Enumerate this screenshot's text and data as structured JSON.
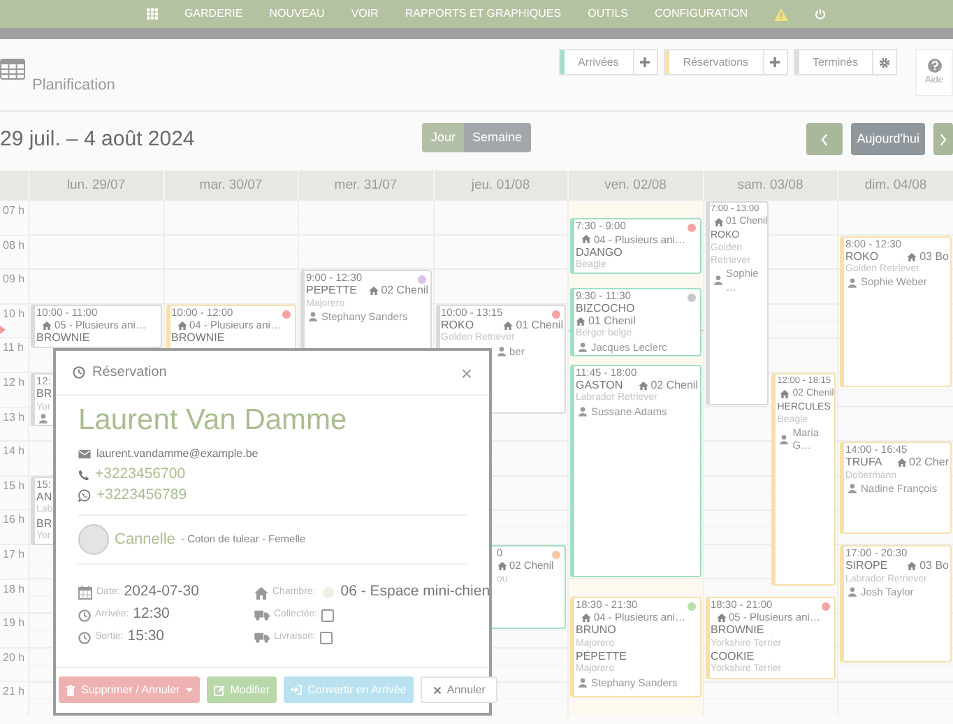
{
  "nav": {
    "items": [
      "GARDERIE",
      "NOUVEAU",
      "VOIR",
      "RAPPORTS ET GRAPHIQUES",
      "OUTILS",
      "CONFIGURATION"
    ]
  },
  "header": {
    "title": "Planification",
    "filters": [
      {
        "label": "Arrivées",
        "kind": "arrival"
      },
      {
        "label": "Réservations",
        "kind": "reservation"
      },
      {
        "label": "Terminés",
        "kind": "done"
      }
    ],
    "help": "Aide"
  },
  "toolbar": {
    "range": "29 juil. – 4 août 2024",
    "views": [
      {
        "label": "Jour",
        "selected": false
      },
      {
        "label": "Semaine",
        "selected": true
      }
    ],
    "today": "Aujourd'hui"
  },
  "calendar": {
    "hours": [
      "07 h",
      "08 h",
      "09 h",
      "10 h",
      "11 h",
      "12 h",
      "13 h",
      "14 h",
      "15 h",
      "16 h",
      "17 h",
      "18 h",
      "19 h",
      "20 h",
      "21 h"
    ],
    "current_time": {
      "level": 0.252
    },
    "days": [
      {
        "label": "lun. 29/07",
        "today": false,
        "events": [
          {
            "kind": "done",
            "lines": [
              {
                "kind": "time",
                "text": "10:00 - 11:00"
              },
              {
                "kind": "room",
                "text": "05 - Plusieurs ani…"
              },
              {
                "kind": "name",
                "text": "BROWNIE"
              }
            ]
          },
          {
            "kind": "done",
            "lines": [
              {
                "kind": "time",
                "text": "12:"
              },
              {
                "kind": "name",
                "text": "BR"
              },
              {
                "kind": "breed",
                "text": "Yor"
              },
              {
                "kind": "owner"
              }
            ]
          },
          {
            "kind": "done",
            "lines": [
              {
                "kind": "time",
                "text": "15:"
              },
              {
                "kind": "name",
                "text": "AN"
              },
              {
                "kind": "breed",
                "text": "Lab"
              },
              {
                "kind": "name",
                "text": "BR"
              },
              {
                "kind": "breed",
                "text": "Yor"
              }
            ]
          }
        ]
      },
      {
        "label": "mar. 30/07",
        "today": false,
        "events": [
          {
            "kind": "reservation",
            "color": "#f4a3a3",
            "lines": [
              {
                "kind": "time",
                "text": "10:00 - 12:00"
              },
              {
                "kind": "room",
                "text": "04 - Plusieurs ani…"
              },
              {
                "kind": "name",
                "text": "BROWNIE"
              }
            ]
          }
        ]
      },
      {
        "label": "mer. 31/07",
        "today": false,
        "events": [
          {
            "kind": "done",
            "color": "#dcc1ee",
            "lines": [
              {
                "kind": "time",
                "text": "9:00 - 12:30"
              },
              {
                "kind": "name",
                "text": "PEPETTE",
                "room": "02 Chenil"
              },
              {
                "kind": "breed",
                "text": "Majorero"
              },
              {
                "kind": "owner",
                "text": "Stephany Sanders"
              }
            ]
          }
        ]
      },
      {
        "label": "jeu. 01/08",
        "today": false,
        "events": [
          {
            "kind": "done",
            "color": "#f4a3a3",
            "lines": [
              {
                "kind": "time",
                "text": "10:00 - 13:15"
              },
              {
                "kind": "name",
                "text": "ROKO",
                "room": "01 Chenil"
              },
              {
                "kind": "breed",
                "text": "Golden Retriever"
              },
              {
                "kind": "owner",
                "text": "ber",
                "clipped": true
              }
            ]
          },
          {
            "kind": "arrival",
            "color": "#f8c9a0",
            "lines": [
              {
                "kind": "time",
                "text": "0",
                "clipped": true
              },
              {
                "kind": "room",
                "text": "02 Chenil",
                "clipped": true
              },
              {
                "kind": "breed",
                "text": "ou",
                "clipped": true
              }
            ]
          }
        ]
      },
      {
        "label": "ven. 02/08",
        "today": true,
        "events": [
          {
            "kind": "arrival",
            "color": "#f4a3a3",
            "lines": [
              {
                "kind": "time",
                "text": "7:30 - 9:00"
              },
              {
                "kind": "room",
                "text": "04 - Plusieurs ani…"
              },
              {
                "kind": "name",
                "text": "DJANGO"
              },
              {
                "kind": "breed",
                "text": "Beagle"
              }
            ]
          },
          {
            "kind": "arrival",
            "color": "#c8c8c8",
            "lines": [
              {
                "kind": "time",
                "text": "9:30 - 11:30"
              },
              {
                "kind": "name",
                "text": "BIZCOCHO",
                "room": "01 Chenil"
              },
              {
                "kind": "breed",
                "text": "Berger belge"
              },
              {
                "kind": "owner",
                "text": "Jacques Leclerc"
              }
            ]
          },
          {
            "kind": "arrival",
            "lines": [
              {
                "kind": "time",
                "text": "11:45 - 18:00"
              },
              {
                "kind": "name",
                "text": "GASTON",
                "room": "02 Chenil"
              },
              {
                "kind": "breed",
                "text": "Labrador Retriever"
              },
              {
                "kind": "owner",
                "text": "Sussane Adams"
              }
            ]
          },
          {
            "kind": "reservation",
            "color": "#b5e0a8",
            "lines": [
              {
                "kind": "time",
                "text": "18:30 - 21:30"
              },
              {
                "kind": "room",
                "text": "04 - Plusieurs ani…"
              },
              {
                "kind": "name",
                "text": "BRUNO"
              },
              {
                "kind": "breed",
                "text": "Majorero"
              },
              {
                "kind": "name",
                "text": "PÉPETTE"
              },
              {
                "kind": "breed",
                "text": "Majorero"
              },
              {
                "kind": "owner",
                "text": "Stephany Sanders"
              }
            ]
          }
        ]
      },
      {
        "label": "sam. 03/08",
        "today": false,
        "events": [
          {
            "kind": "done",
            "lines": [
              {
                "kind": "time",
                "text": "7:00 - 13:00"
              },
              {
                "kind": "room",
                "text": "01 Chenil"
              },
              {
                "kind": "name",
                "text": "ROKO"
              },
              {
                "kind": "breed",
                "text": "Golden"
              },
              {
                "kind": "breed",
                "text": "Retriever"
              },
              {
                "kind": "owner",
                "text": "Sophie …"
              }
            ]
          },
          {
            "kind": "reservation",
            "lines": [
              {
                "kind": "time",
                "text": "12:00 - 18:15"
              },
              {
                "kind": "room",
                "text": "02 Chenil"
              },
              {
                "kind": "name",
                "text": "HERCULES"
              },
              {
                "kind": "breed",
                "text": "Beagle"
              },
              {
                "kind": "owner",
                "text": "Maria G…"
              }
            ]
          },
          {
            "kind": "reservation",
            "color": "#f4a3a3",
            "lines": [
              {
                "kind": "time",
                "text": "18:30 - 21:00"
              },
              {
                "kind": "room",
                "text": "05 - Plusieurs ani…"
              },
              {
                "kind": "name",
                "text": "BROWNIE"
              },
              {
                "kind": "breed",
                "text": "Yorkshire Terrier"
              },
              {
                "kind": "name",
                "text": "COOKIE"
              },
              {
                "kind": "breed",
                "text": "Yorkshire Terrier"
              }
            ]
          }
        ]
      },
      {
        "label": "dim. 04/08",
        "today": false,
        "events": [
          {
            "kind": "reservation",
            "lines": [
              {
                "kind": "time",
                "text": "8:00 - 12:30"
              },
              {
                "kind": "name",
                "text": "ROKO",
                "room": "03 Bo"
              },
              {
                "kind": "breed",
                "text": "Golden Retriever"
              },
              {
                "kind": "owner",
                "text": "Sophie Weber"
              }
            ]
          },
          {
            "kind": "reservation",
            "lines": [
              {
                "kind": "time",
                "text": "14:00 - 16:45"
              },
              {
                "kind": "name",
                "text": "TRUFA",
                "room": "02 Cher"
              },
              {
                "kind": "breed",
                "text": "Dobermann"
              },
              {
                "kind": "owner",
                "text": "Nadine François"
              }
            ]
          },
          {
            "kind": "reservation",
            "lines": [
              {
                "kind": "time",
                "text": "17:00 - 20:30"
              },
              {
                "kind": "name",
                "text": "SIROPE",
                "room": "03 Bo"
              },
              {
                "kind": "breed",
                "text": "Labrador Retriever"
              },
              {
                "kind": "owner",
                "text": "Josh Taylor"
              }
            ]
          }
        ]
      }
    ]
  },
  "dialog": {
    "title": "Réservation",
    "close": "×",
    "client": {
      "name": "Laurent Van Damme",
      "email": "laurent.vandamme@example.be",
      "phone": "+3223456700",
      "whatsapp": "+3223456789"
    },
    "pet": {
      "name": "Cannelle",
      "details": " - Coton de tulear - Femelle"
    },
    "left": [
      {
        "kind": "date",
        "label": "Date:",
        "value": "2024-07-30"
      },
      {
        "kind": "arrival",
        "label": "Arrivée:",
        "value": "12:30"
      },
      {
        "kind": "departure",
        "label": "Sortie:",
        "value": "15:30"
      }
    ],
    "right": [
      {
        "kind": "room",
        "label": "Chambre:",
        "value": "06 - Espace mini-chien"
      },
      {
        "kind": "pickup",
        "label": "Collectée:",
        "checked": false
      },
      {
        "kind": "delivery",
        "label": "Livraison:",
        "checked": false
      }
    ],
    "buttons": [
      {
        "kind": "delete",
        "label": "Supprimer / Annuler"
      },
      {
        "kind": "edit",
        "label": "Modifier"
      },
      {
        "kind": "convert",
        "label": "Convertir en Arrivée"
      },
      {
        "kind": "cancel",
        "label": "Annuler"
      }
    ]
  }
}
